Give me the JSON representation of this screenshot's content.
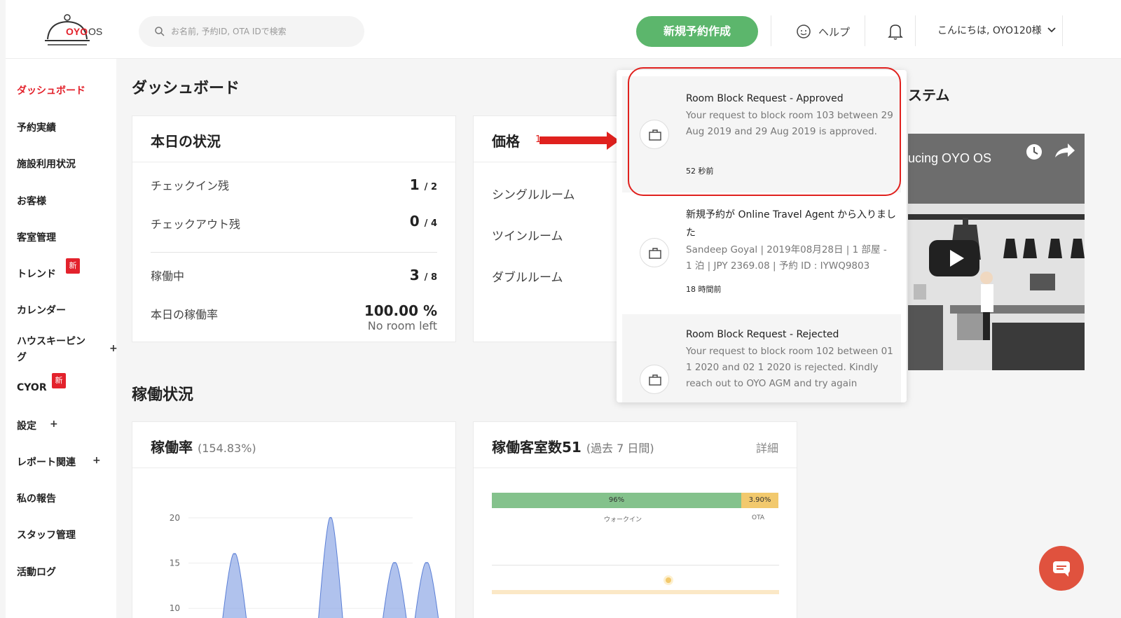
{
  "header": {
    "logo_text": "OYO",
    "logo_os": "OS",
    "search_placeholder": "お名前, 予約ID, OTA IDで検索",
    "new_booking": "新規予約作成",
    "help": "ヘルプ",
    "greeting": "こんにちは, OYO120様"
  },
  "sidebar": {
    "items": [
      {
        "label": "ダッシュボード"
      },
      {
        "label": "予約実績"
      },
      {
        "label": "施設利用状況"
      },
      {
        "label": "お客様"
      },
      {
        "label": "客室管理"
      },
      {
        "label": "トレンド"
      },
      {
        "label": "カレンダー"
      },
      {
        "label": "ハウスキーピン"
      },
      {
        "label": "グ"
      },
      {
        "label": "CYOR"
      },
      {
        "label": "設定"
      },
      {
        "label": "レポート関連"
      },
      {
        "label": "私の報告"
      },
      {
        "label": "スタッフ管理"
      },
      {
        "label": "活動ログ"
      }
    ],
    "badge_new": "新",
    "plus": "+"
  },
  "main": {
    "title": "ダッシュボード",
    "today": {
      "title": "本日の状況",
      "checkin_label": "チェックイン残",
      "checkin_val": "1",
      "checkin_total": "/ 2",
      "checkout_label": "チェックアウト残",
      "checkout_val": "0",
      "checkout_total": "/ 4",
      "occupied_label": "稼働中",
      "occupied_val": "3",
      "occupied_total": "/ 8",
      "rate_label": "本日の稼働率",
      "rate_val": "100.00 %",
      "no_room": "No room left"
    },
    "price": {
      "title": "価格",
      "marker": "1",
      "single": "シングルルーム",
      "twin": "ツインルーム",
      "double": "ダブルルーム"
    },
    "ops_title": "稼働状況",
    "occupancy": {
      "title": "稼働率",
      "sub": "(154.83%)"
    },
    "rooms": {
      "title": "稼働客室数51",
      "sub": "(過去 7 日間)",
      "detail": "詳細",
      "walkin_pct": "96%",
      "ota_pct": "3.90%",
      "walkin_label": "ウォークイン",
      "ota_label": "OTA"
    },
    "video_title": "ステム",
    "video_caption": "ucing OYO OS"
  },
  "chart_data": {
    "type": "area",
    "ylim": [
      7,
      22
    ],
    "yticks": [
      20,
      15,
      10
    ],
    "ylabel": "",
    "series": [
      {
        "values": [
          0,
          16,
          0,
          0,
          20,
          0,
          15,
          15
        ]
      }
    ]
  },
  "notifications": [
    {
      "title": "Room Block Request - Approved",
      "body": "Your request to block room 103 between 29 Aug 2019 and 29 Aug 2019 is approved.",
      "time": "52 秒前"
    },
    {
      "title": "新規予約が Online Travel Agent から入りました",
      "body": "Sandeep Goyal | 2019年08月28日 | 1 部屋 - 1 泊 | JPY 2369.08 | 予約 ID : IYWQ9803",
      "time": "18 時間前"
    },
    {
      "title": "Room Block Request - Rejected",
      "body": "Your request to block room 102 between 01 1 2020 and 02 1 2020 is rejected. Kindly reach out to OYO AGM and try again",
      "time": ""
    }
  ],
  "colors": {
    "brand_red": "#e3222c",
    "green": "#5cb66c",
    "walkin_bar": "#84c28c",
    "ota_bar": "#f2c96d",
    "chart_fill": "#8fa8e6"
  }
}
